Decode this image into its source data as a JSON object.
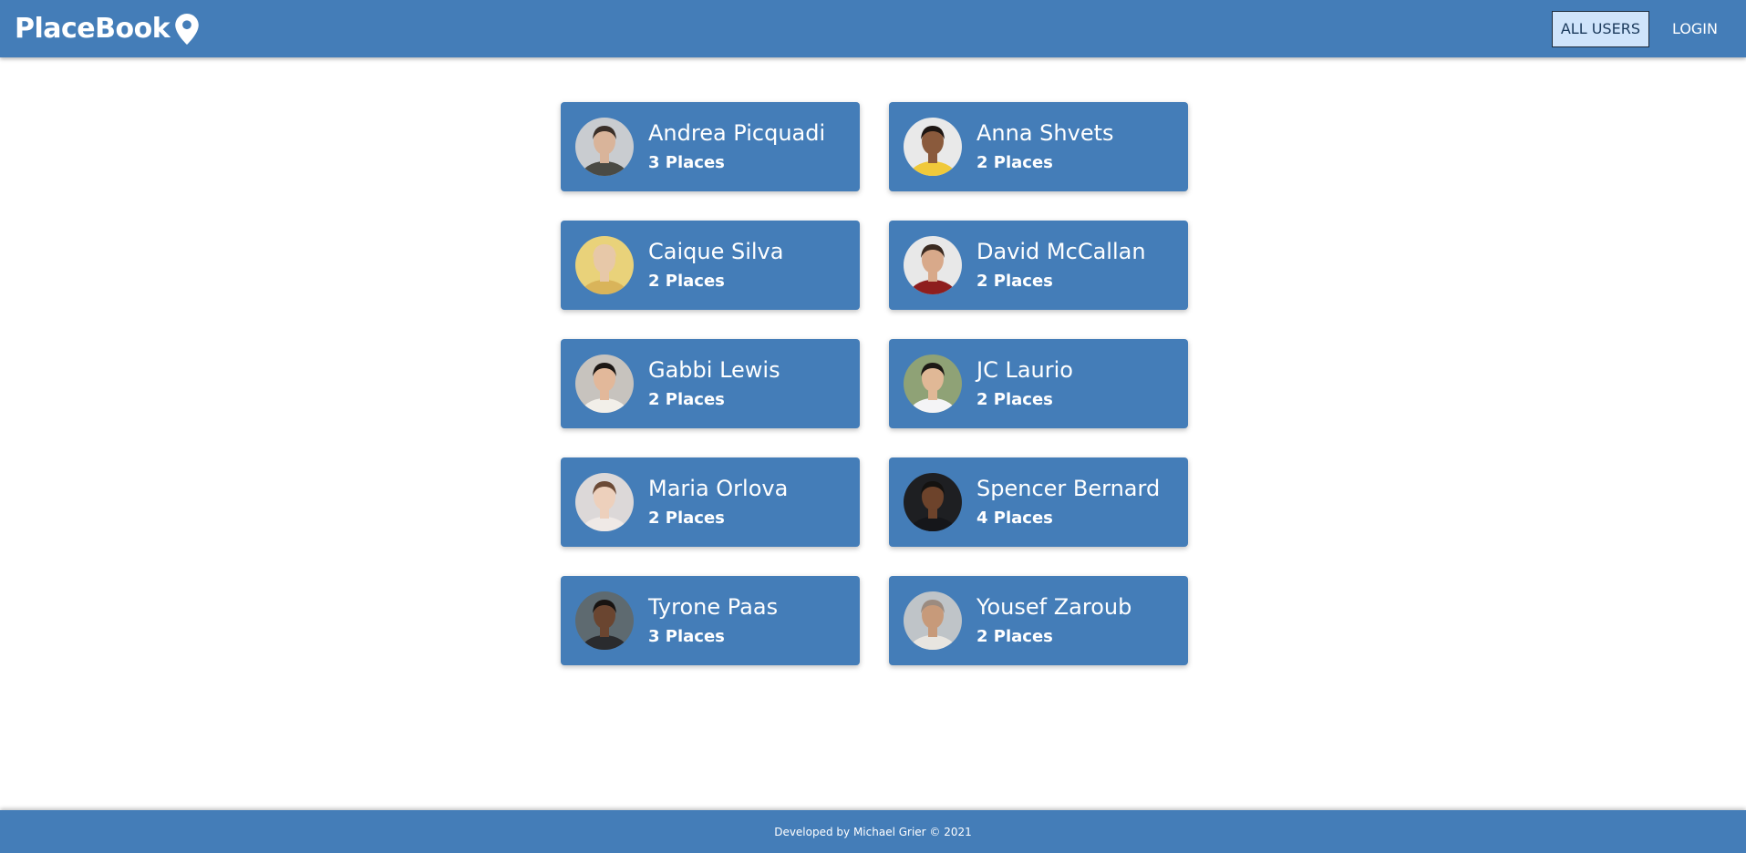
{
  "header": {
    "brand_title": "PlaceBook",
    "brand_icon": "map-pin-icon",
    "nav": [
      {
        "label": "ALL USERS",
        "active": true
      },
      {
        "label": "LOGIN",
        "active": false
      }
    ]
  },
  "users": [
    {
      "name": "Andrea Picquadi",
      "places": "3 Places",
      "avatar": {
        "bg": "#c9ccd0",
        "skin": "#d9b49a",
        "hair": "#3a2f28",
        "shirt": "#4a4a44"
      }
    },
    {
      "name": "Anna Shvets",
      "places": "2 Places",
      "avatar": {
        "bg": "#e9e9e9",
        "skin": "#8a5a3c",
        "hair": "#1e1612",
        "shirt": "#f0c93a"
      }
    },
    {
      "name": "Caique Silva",
      "places": "2 Places",
      "avatar": {
        "bg": "#e9d27a",
        "skin": "#e7c8a8",
        "hair": "#e7c8a8",
        "shirt": "#d9b45a"
      }
    },
    {
      "name": "David McCallan",
      "places": "2 Places",
      "avatar": {
        "bg": "#e8e8e8",
        "skin": "#d8a98a",
        "hair": "#3b2a20",
        "shirt": "#8e1e1e"
      }
    },
    {
      "name": "Gabbi Lewis",
      "places": "2 Places",
      "avatar": {
        "bg": "#c7c3be",
        "skin": "#e2b89a",
        "hair": "#1c1714",
        "shirt": "#f2efe9"
      }
    },
    {
      "name": "JC Laurio",
      "places": "2 Places",
      "avatar": {
        "bg": "#8fa276",
        "skin": "#e0b896",
        "hair": "#1d1915",
        "shirt": "#f4f4f6"
      }
    },
    {
      "name": "Maria Orlova",
      "places": "2 Places",
      "avatar": {
        "bg": "#dcd8d8",
        "skin": "#edd0bc",
        "hair": "#6b4a36",
        "shirt": "#efe9e6"
      }
    },
    {
      "name": "Spencer Bernard",
      "places": "4 Places",
      "avatar": {
        "bg": "#1e1f22",
        "skin": "#6d432b",
        "hair": "#141210",
        "shirt": "#15161a"
      }
    },
    {
      "name": "Tyrone Paas",
      "places": "3 Places",
      "avatar": {
        "bg": "#5e6a70",
        "skin": "#6a4530",
        "hair": "#171311",
        "shirt": "#2a2b2e"
      }
    },
    {
      "name": "Yousef Zaroub",
      "places": "2 Places",
      "avatar": {
        "bg": "#bfc4c8",
        "skin": "#c79a7a",
        "hair": "#9b8b80",
        "shirt": "#e8e5e0"
      }
    }
  ],
  "footer": {
    "text": "Developed by Michael Grier © 2021"
  },
  "colors": {
    "primary": "#447db8",
    "active_nav_bg": "#cfe4fb",
    "text_light": "#ffffff"
  }
}
